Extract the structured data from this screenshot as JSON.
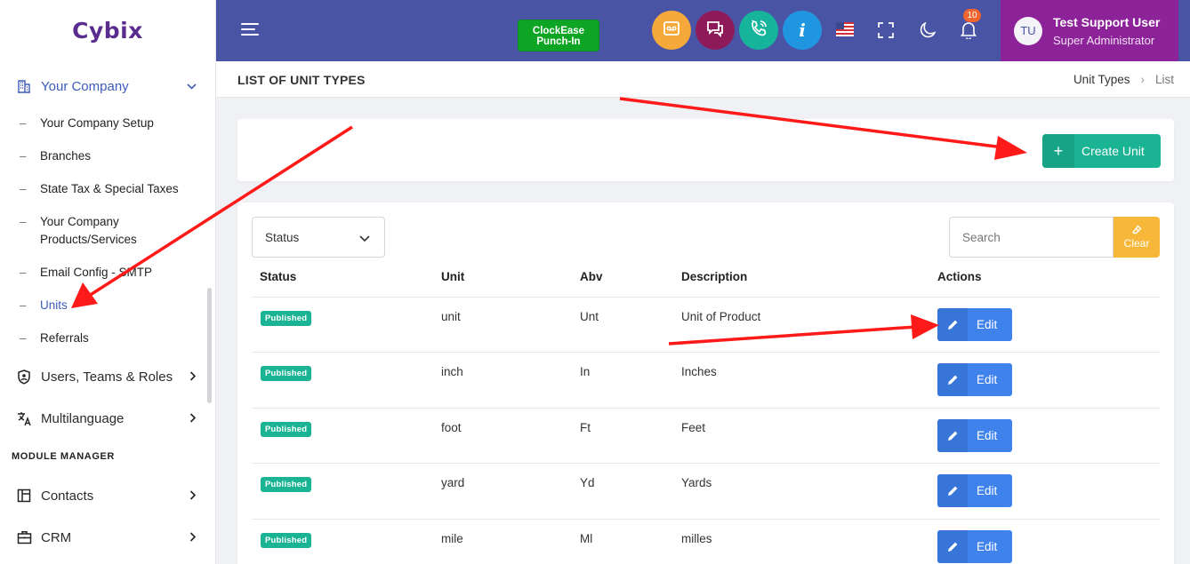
{
  "brand": {
    "logo": "Cybix"
  },
  "sidebar": {
    "parent": "Your Company",
    "sub_items": [
      {
        "label": "Your Company Setup"
      },
      {
        "label": "Branches"
      },
      {
        "label": "State Tax & Special Taxes"
      },
      {
        "label": "Your Company Products/Services"
      },
      {
        "label": "Email Config - SMTP"
      },
      {
        "label": "Units"
      },
      {
        "label": "Referrals"
      }
    ],
    "groups": [
      {
        "label": "Users, Teams & Roles"
      },
      {
        "label": "Multilanguage"
      }
    ],
    "section_label": "MODULE MANAGER",
    "modules": [
      {
        "label": "Contacts"
      },
      {
        "label": "CRM"
      }
    ]
  },
  "header": {
    "punch_line1": "ClockEase",
    "punch_line2": "Punch-In",
    "info_glyph": "i",
    "notification_count": "10",
    "user_initials": "TU",
    "user_name": "Test Support User",
    "user_role": "Super Administrator",
    "colors": {
      "bar": "#4a54a5",
      "user_box": "#8d2398"
    }
  },
  "page": {
    "title": "LIST OF UNIT TYPES",
    "breadcrumb": [
      "Unit Types",
      "List"
    ]
  },
  "toolbar": {
    "create_label": "Create Unit",
    "status_filter": "Status",
    "search_placeholder": "Search",
    "clear_label": "Clear"
  },
  "table": {
    "headers": [
      "Status",
      "Unit",
      "Abv",
      "Description",
      "Actions"
    ],
    "rows": [
      {
        "status": "Published",
        "unit": "unit",
        "abv": "Unt",
        "description": "Unit of Product",
        "action": "Edit"
      },
      {
        "status": "Published",
        "unit": "inch",
        "abv": "In",
        "description": "Inches",
        "action": "Edit"
      },
      {
        "status": "Published",
        "unit": "foot",
        "abv": "Ft",
        "description": "Feet",
        "action": "Edit"
      },
      {
        "status": "Published",
        "unit": "yard",
        "abv": "Yd",
        "description": "Yards",
        "action": "Edit"
      },
      {
        "status": "Published",
        "unit": "mile",
        "abv": "Ml",
        "description": "milles",
        "action": "Edit"
      }
    ]
  }
}
